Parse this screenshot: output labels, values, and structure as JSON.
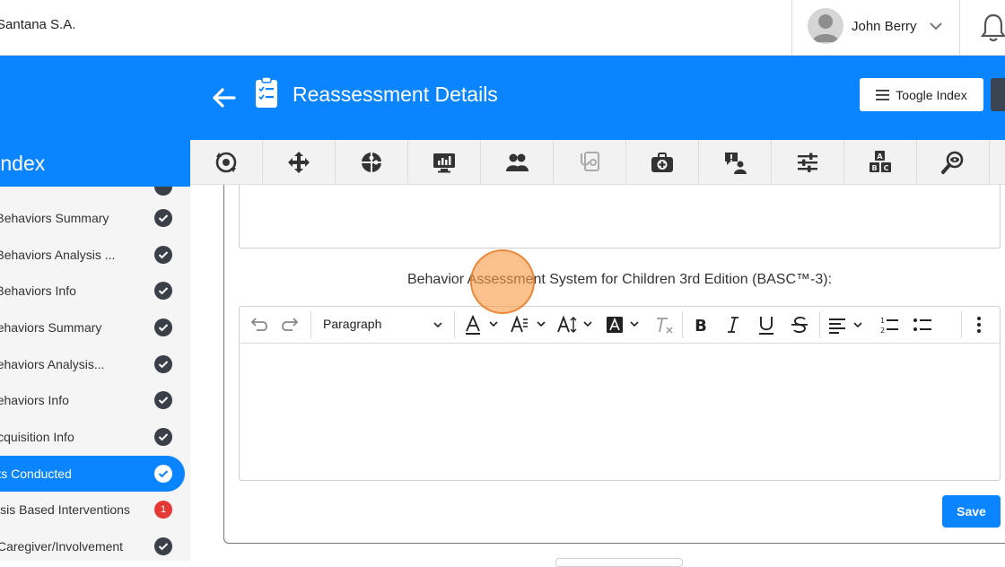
{
  "topbar": {
    "org_name": "Santana S.A.",
    "user_name": "John Berry",
    "avatar_icon": "user-avatar-icon",
    "notifications_icon": "bell-icon"
  },
  "header": {
    "title": "Reassessment Details",
    "toggle_index_label": "Toogle Index",
    "accent_color": "#0a84ff"
  },
  "index": {
    "label": "Index"
  },
  "icon_toolbar": [
    "sync-target-icon",
    "move-arrows-icon",
    "puzzle-icon",
    "monitor-chart-icon",
    "users-group-icon",
    "stethoscope-icon",
    "medical-kit-icon",
    "alert-person-icon",
    "sliders-icon",
    "abc-blocks-icon",
    "search-eye-icon"
  ],
  "sidebar": {
    "items": [
      {
        "label": "Adaptive Behaviors Summary",
        "status": "done"
      },
      {
        "label": "Adaptive Behaviors Analysis ...",
        "status": "done"
      },
      {
        "label": "Adaptive Behaviors Info",
        "status": "done"
      },
      {
        "label": "Replacement Behaviors Summary",
        "status": "done"
      },
      {
        "label": "Replacement Behaviors Analysis...",
        "status": "done"
      },
      {
        "label": "Replacement Behaviors Info",
        "status": "done"
      },
      {
        "label": "Skill Acquisition Info",
        "status": "done"
      },
      {
        "label": "Assessments Conducted",
        "status": "done",
        "active": true
      },
      {
        "label": "Hypothesis Based Interventions",
        "status": "badge",
        "badge": "1"
      },
      {
        "label": "Caregiver/Involvement",
        "status": "done"
      }
    ]
  },
  "form": {
    "field_label": "Behavior Assessment System for Children 3rd Edition (BASC™-3):",
    "editor": {
      "block_format": "Paragraph",
      "value": ""
    },
    "save_label": "Save"
  }
}
